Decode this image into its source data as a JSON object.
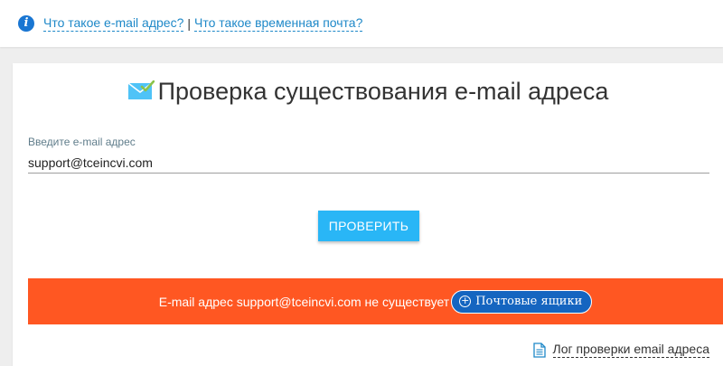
{
  "help": {
    "link1": "Что такое e-mail адрес?",
    "separator": "|",
    "link2": "Что такое временная почта?"
  },
  "page": {
    "title": "Проверка существования e-mail адреса"
  },
  "form": {
    "email_label": "Введите e-mail адрес",
    "email_value": "support@tceincvi.com",
    "check_button": "ПРОВЕРИТЬ"
  },
  "result": {
    "message": "E-mail адрес support@tceincvi.com не существует",
    "mailbox_button": "Почтовые ящики"
  },
  "footer": {
    "log_link": "Лог проверки email адреса"
  },
  "icons": {
    "info": "info-icon",
    "mail": "mail-check-icon",
    "plus": "plus-circle-icon",
    "document": "document-icon"
  },
  "colors": {
    "accent": "#29b6f6",
    "link": "#1e88c8",
    "error": "#ff5722",
    "mailbox_button": "#1565c0"
  }
}
